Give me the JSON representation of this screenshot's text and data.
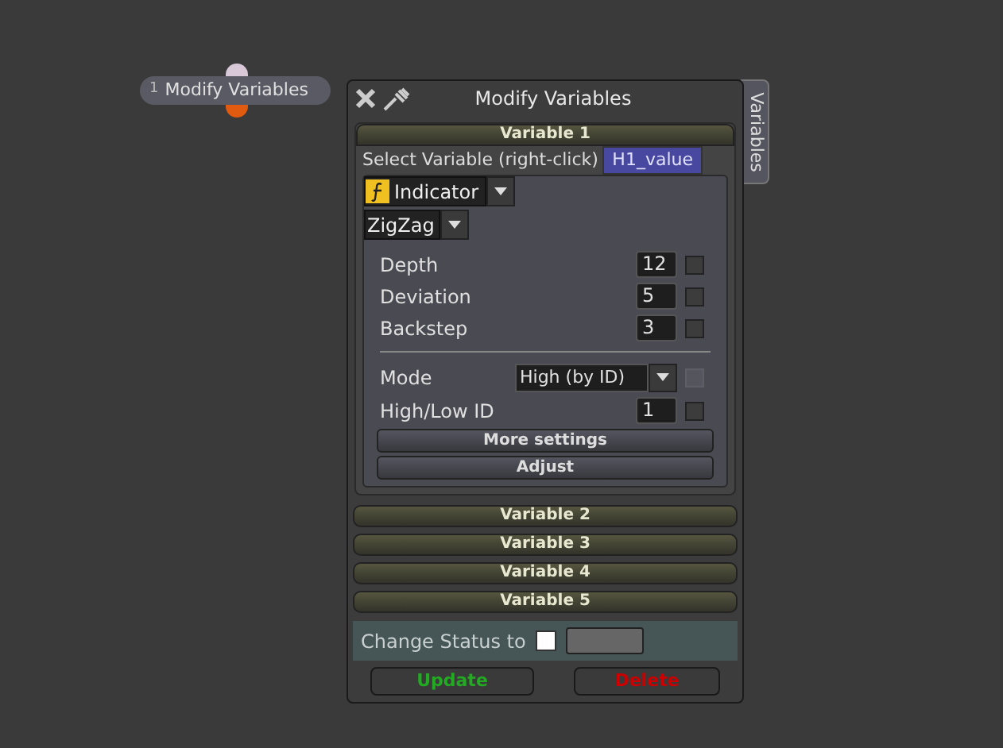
{
  "node": {
    "index": "1",
    "label": "Modify Variables"
  },
  "window": {
    "title": "Modify Variables",
    "side_tab": "Variables"
  },
  "variables": [
    {
      "title": "Variable 1",
      "expanded": true
    },
    {
      "title": "Variable 2",
      "expanded": false
    },
    {
      "title": "Variable 3",
      "expanded": false
    },
    {
      "title": "Variable 4",
      "expanded": false
    },
    {
      "title": "Variable 5",
      "expanded": false
    }
  ],
  "select_variable": {
    "label": "Select Variable (right-click)",
    "value": "H1_value"
  },
  "source": {
    "type": "Indicator",
    "indicator": "ZigZag"
  },
  "params": [
    {
      "kind": "number",
      "label": "Depth",
      "value": "12",
      "checked": false,
      "disabled": false
    },
    {
      "kind": "number",
      "label": "Deviation",
      "value": "5",
      "checked": false,
      "disabled": false
    },
    {
      "kind": "number",
      "label": "Backstep",
      "value": "3",
      "checked": false,
      "disabled": false
    },
    {
      "kind": "divider"
    },
    {
      "kind": "dropdown",
      "label": "Mode",
      "value": "High (by ID)",
      "checked": false,
      "disabled": true
    },
    {
      "kind": "number",
      "label": "High/Low ID",
      "value": "1",
      "checked": false,
      "disabled": false
    }
  ],
  "panel_buttons": [
    "More settings",
    "Adjust"
  ],
  "status": {
    "label": "Change Status to",
    "checked": false
  },
  "buttons": [
    {
      "label": "Update",
      "color": "#22aa22"
    },
    {
      "label": "Delete",
      "color": "#cc0000"
    }
  ]
}
